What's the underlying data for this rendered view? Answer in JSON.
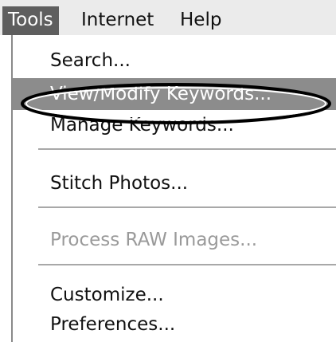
{
  "menubar": {
    "items": [
      {
        "label": "Tools",
        "active": true
      },
      {
        "label": "Internet",
        "active": false
      },
      {
        "label": "Help",
        "active": false
      }
    ]
  },
  "tools_menu": {
    "items": [
      {
        "label": "Search...",
        "state": "normal"
      },
      {
        "label": "View/Modify Keywords...",
        "state": "highlighted"
      },
      {
        "label": "Manage Keywords...",
        "state": "normal"
      },
      {
        "label": "Stitch Photos...",
        "state": "normal"
      },
      {
        "label": "Process RAW Images...",
        "state": "disabled"
      },
      {
        "label": "Customize...",
        "state": "normal"
      },
      {
        "label": "Preferences...",
        "state": "normal"
      }
    ]
  },
  "colors": {
    "menubar_background": "#ebebeb",
    "active_menu_background": "#5e5e5e",
    "highlight_background": "#8c8c8c",
    "disabled_text": "#9a9a9a",
    "annotation_ellipse": "#000000"
  }
}
